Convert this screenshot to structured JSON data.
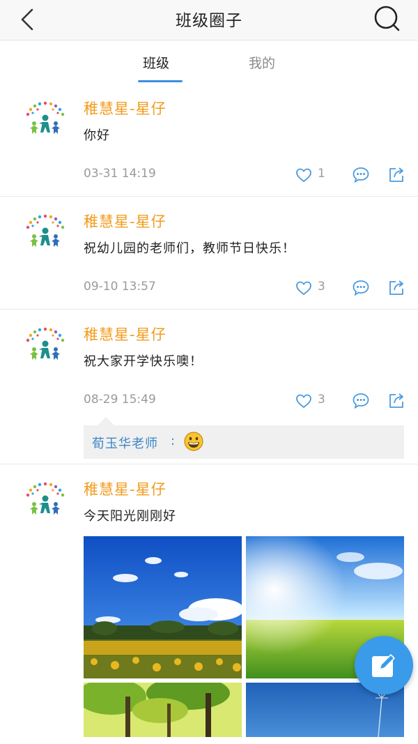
{
  "header": {
    "title": "班级圈子",
    "back_icon": "back-arrow-icon",
    "search_icon": "search-icon"
  },
  "tabs": [
    {
      "label": "班级",
      "active": true
    },
    {
      "label": "我的",
      "active": false
    }
  ],
  "colors": {
    "accent": "#3b8fe0",
    "author": "#f29b1b",
    "reply_name": "#3d86c8",
    "meta_gray": "#9a9a9a",
    "fab": "#3a9bea"
  },
  "posts": [
    {
      "author": "稚慧星-星仔",
      "content": "你好",
      "time": "03-31 14:19",
      "likes": "1"
    },
    {
      "author": "稚慧星-星仔",
      "content": "祝幼儿园的老师们，教师节日快乐！",
      "time": "09-10 13:57",
      "likes": "3"
    },
    {
      "author": "稚慧星-星仔",
      "content": "祝大家开学快乐噢！",
      "time": "08-29 15:49",
      "likes": "3",
      "reply": {
        "name": "荀玉华老师",
        "colon": ":",
        "emoji": "grinning-face-emoji"
      }
    },
    {
      "author": "稚慧星-星仔",
      "content": "今天阳光刚刚好",
      "photos": [
        "sunflower-field-photo",
        "green-meadow-sunlight-photo",
        "trees-photo",
        "dandelion-blue-sky-photo"
      ]
    }
  ],
  "fab": {
    "icon": "compose-icon"
  }
}
